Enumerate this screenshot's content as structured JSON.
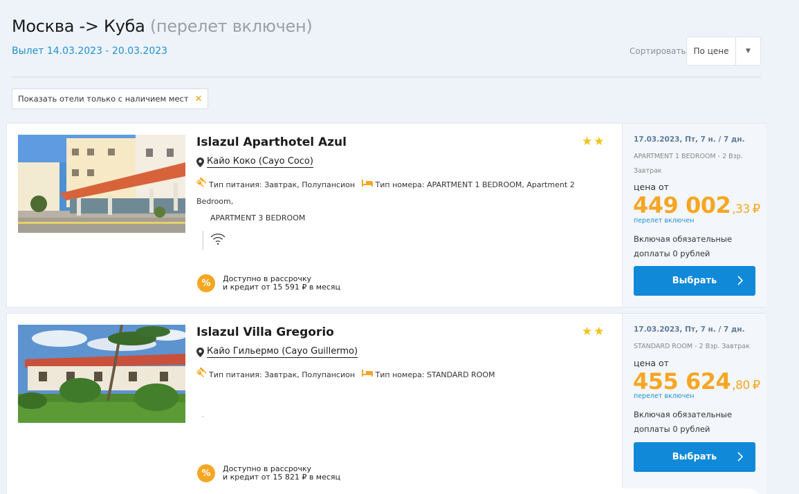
{
  "header": {
    "title": "Москва -> Куба",
    "title_sub": "(перелет включен)",
    "dates": "Вылет 14.03.2023 - 20.03.2023"
  },
  "sort": {
    "label": "Сортировать",
    "value": "По цене"
  },
  "filter_chip": {
    "label": "Показать отели только с наличием мест"
  },
  "hotels": [
    {
      "name": "Islazul Aparthotel Azul",
      "stars": "★★",
      "location": "Кайо Коко (Cayo Coco)",
      "meal": "Тип питания: Завтрак, Полупансион",
      "room_type": "Тип номера: APARTMENT 1 BEDROOM, Apartment 2 Bedroom,",
      "room_type_cont": "APARTMENT 3 BEDROOM",
      "credit_line1": "Доступно в рассрочку",
      "credit_line2": "и кредит от 15 591 ₽ в месяц",
      "offer_date": "17.03.2023, Пт, 7 н. / 7 дн.",
      "offer_room": "APARTMENT 1 BEDROOM - 2 Взр. Завтрак",
      "price_from": "цена от",
      "price_main": "449 002",
      "price_cents": ",33",
      "currency": "₽",
      "flight_included": "перелет включен",
      "fees": "Включая обязательные доплаты 0 рублей",
      "button": "Выбрать"
    },
    {
      "name": "Islazul Villa Gregorio",
      "stars": "★★",
      "location": "Кайо Гильермо (Cayo Guillermo)",
      "meal": "Тип питания: Завтрак, Полупансион",
      "room_type": "Тип номера: STANDARD ROOM",
      "credit_line1": "Доступно в рассрочку",
      "credit_line2": "и кредит от 15 821 ₽ в месяц",
      "offer_date": "17.03.2023, Пт, 7 н. / 7 дн.",
      "offer_room": "STANDARD ROOM - 2 Взр.  Завтрак",
      "price_from": "цена от",
      "price_main": "455 624",
      "price_cents": ",80",
      "currency": "₽",
      "flight_included": "перелет включен",
      "fees": "Включая обязательные доплаты 0 рублей",
      "button": "Выбрать"
    }
  ],
  "colors": {
    "accent_blue": "#1089d8",
    "price_orange": "#f5a623",
    "star_yellow": "#f0c21b",
    "link_blue": "#1e90d0"
  },
  "icons": [
    "chevron-down-icon",
    "close-icon",
    "map-pin-icon",
    "cutlery-icon",
    "bed-icon",
    "wifi-icon",
    "percent-icon",
    "chevron-right-icon"
  ]
}
